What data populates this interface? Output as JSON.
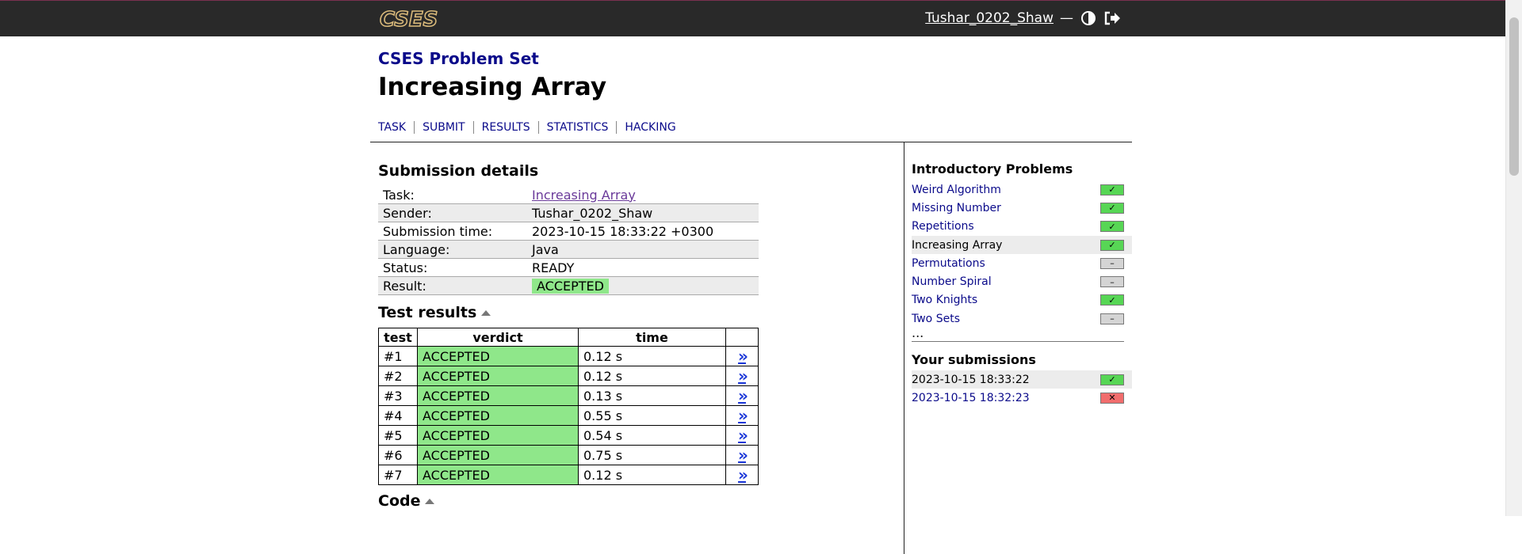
{
  "header": {
    "logo_text": "CSES",
    "username": "Tushar_0202_Shaw",
    "separator": "—",
    "icons": [
      "contrast-icon",
      "logout-icon"
    ]
  },
  "page": {
    "set_title": "CSES Problem Set",
    "problem_title": "Increasing Array",
    "tabs": [
      "TASK",
      "SUBMIT",
      "RESULTS",
      "STATISTICS",
      "HACKING"
    ]
  },
  "submission": {
    "heading": "Submission details",
    "rows": [
      {
        "label": "Task:",
        "value": "Increasing Array"
      },
      {
        "label": "Sender:",
        "value": "Tushar_0202_Shaw"
      },
      {
        "label": "Submission time:",
        "value": "2023-10-15 18:33:22 +0300"
      },
      {
        "label": "Language:",
        "value": "Java"
      },
      {
        "label": "Status:",
        "value": "READY"
      },
      {
        "label": "Result:",
        "value": "ACCEPTED"
      }
    ]
  },
  "tests": {
    "heading": "Test results",
    "columns": [
      "test",
      "verdict",
      "time",
      ""
    ],
    "rows": [
      {
        "test": "#1",
        "verdict": "ACCEPTED",
        "time": "0.12 s",
        "link": "»"
      },
      {
        "test": "#2",
        "verdict": "ACCEPTED",
        "time": "0.12 s",
        "link": "»"
      },
      {
        "test": "#3",
        "verdict": "ACCEPTED",
        "time": "0.13 s",
        "link": "»"
      },
      {
        "test": "#4",
        "verdict": "ACCEPTED",
        "time": "0.55 s",
        "link": "»"
      },
      {
        "test": "#5",
        "verdict": "ACCEPTED",
        "time": "0.54 s",
        "link": "»"
      },
      {
        "test": "#6",
        "verdict": "ACCEPTED",
        "time": "0.75 s",
        "link": "»"
      },
      {
        "test": "#7",
        "verdict": "ACCEPTED",
        "time": "0.12 s",
        "link": "»"
      }
    ]
  },
  "code": {
    "heading": "Code"
  },
  "sidebar": {
    "section_title": "Introductory Problems",
    "problems": [
      {
        "name": "Weird Algorithm",
        "status": "ok",
        "mark": "✓"
      },
      {
        "name": "Missing Number",
        "status": "ok",
        "mark": "✓"
      },
      {
        "name": "Repetitions",
        "status": "ok",
        "mark": "✓"
      },
      {
        "name": "Increasing Array",
        "status": "ok",
        "mark": "✓",
        "current": true
      },
      {
        "name": "Permutations",
        "status": "none",
        "mark": "–"
      },
      {
        "name": "Number Spiral",
        "status": "none",
        "mark": "–"
      },
      {
        "name": "Two Knights",
        "status": "ok",
        "mark": "✓"
      },
      {
        "name": "Two Sets",
        "status": "none",
        "mark": "–"
      }
    ],
    "more": "...",
    "submissions_title": "Your submissions",
    "submissions": [
      {
        "time": "2023-10-15 18:33:22",
        "status": "ok",
        "mark": "✓",
        "current": true
      },
      {
        "time": "2023-10-15 18:32:23",
        "status": "fail",
        "mark": "✕"
      }
    ]
  },
  "colors": {
    "topbar": "#292929",
    "link": "#0a0a8a",
    "accepted": "#8fe78a",
    "ok_badge": "#57d655",
    "fail_badge": "#f16d6d"
  }
}
